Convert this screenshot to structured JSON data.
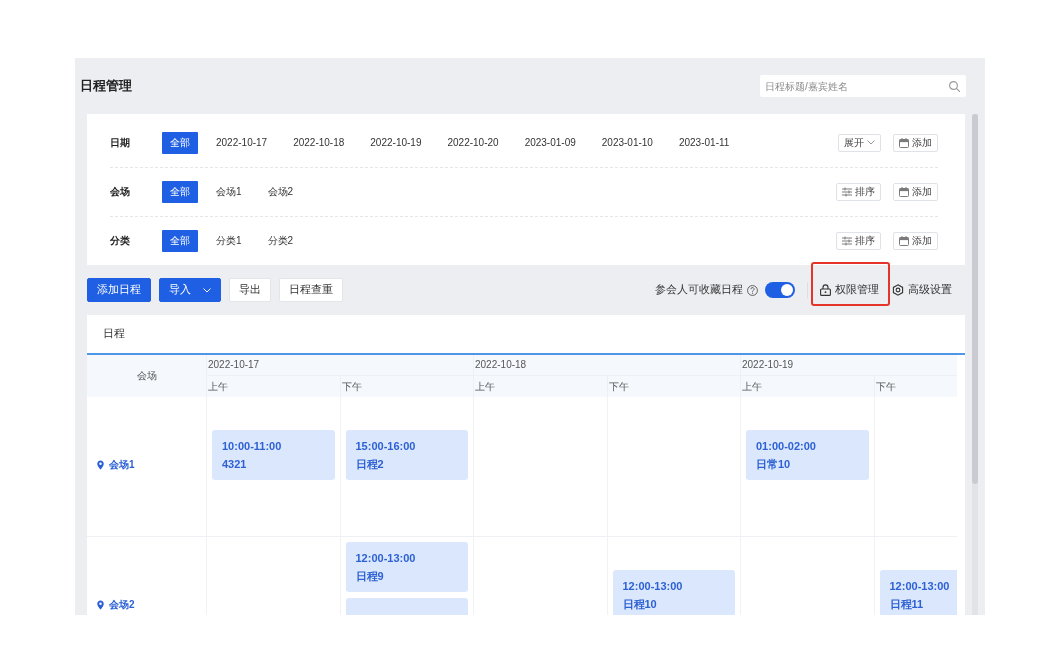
{
  "page": {
    "title": "日程管理"
  },
  "search": {
    "placeholder": "日程标题/嘉宾姓名"
  },
  "filters": [
    {
      "label": "日期",
      "options": [
        {
          "label": "全部",
          "selected": true
        },
        {
          "label": "2022-10-17",
          "selected": false
        },
        {
          "label": "2022-10-18",
          "selected": false
        },
        {
          "label": "2022-10-19",
          "selected": false
        },
        {
          "label": "2022-10-20",
          "selected": false
        },
        {
          "label": "2023-01-09",
          "selected": false
        },
        {
          "label": "2023-01-10",
          "selected": false
        },
        {
          "label": "2023-01-11",
          "selected": false
        }
      ],
      "actions": [
        {
          "kind": "expand",
          "label": "展开"
        },
        {
          "kind": "add",
          "label": "添加"
        }
      ]
    },
    {
      "label": "会场",
      "options": [
        {
          "label": "全部",
          "selected": true
        },
        {
          "label": "会场1",
          "selected": false
        },
        {
          "label": "会场2",
          "selected": false
        }
      ],
      "actions": [
        {
          "kind": "sort",
          "label": "排序"
        },
        {
          "kind": "add",
          "label": "添加"
        }
      ]
    },
    {
      "label": "分类",
      "options": [
        {
          "label": "全部",
          "selected": true
        },
        {
          "label": "分类1",
          "selected": false
        },
        {
          "label": "分类2",
          "selected": false
        }
      ],
      "actions": [
        {
          "kind": "sort",
          "label": "排序"
        },
        {
          "kind": "add",
          "label": "添加"
        }
      ]
    }
  ],
  "toolbar": {
    "buttons": [
      {
        "label": "添加日程",
        "kind": "primary",
        "dropdown": false
      },
      {
        "label": "导入",
        "kind": "primary",
        "dropdown": true
      },
      {
        "label": "导出",
        "kind": "default",
        "dropdown": false
      },
      {
        "label": "日程查重",
        "kind": "default",
        "dropdown": false
      }
    ],
    "favorite_toggle": {
      "label": "参会人可收藏日程",
      "on": true
    },
    "actions": [
      {
        "kind": "permissions",
        "label": "权限管理",
        "highlighted": true
      },
      {
        "kind": "settings",
        "label": "高级设置",
        "highlighted": false
      }
    ]
  },
  "schedule": {
    "tabs": [
      {
        "label": "日程",
        "selected": true
      }
    ],
    "venue_header": "会场",
    "dates": [
      {
        "label": "2022-10-17",
        "halves": [
          "上午",
          "下午"
        ]
      },
      {
        "label": "2022-10-18",
        "halves": [
          "上午",
          "下午"
        ]
      },
      {
        "label": "2022-10-19",
        "halves": [
          "上午",
          "下午"
        ]
      }
    ],
    "venues": [
      {
        "name": "会场1",
        "slots": [
          {
            "kind": "events",
            "events": [
              {
                "kind": "entry",
                "time": "10:00-11:00",
                "title": "4321"
              }
            ]
          },
          {
            "kind": "events",
            "events": [
              {
                "kind": "entry",
                "time": "15:00-16:00",
                "title": "日程2"
              }
            ]
          },
          {
            "kind": "empty"
          },
          {
            "kind": "empty"
          },
          {
            "kind": "events",
            "events": [
              {
                "kind": "entry",
                "time": "01:00-02:00",
                "title": "日常10"
              }
            ]
          },
          {
            "kind": "empty"
          }
        ]
      },
      {
        "name": "会场2",
        "slots": [
          {
            "kind": "empty"
          },
          {
            "kind": "events",
            "events": [
              {
                "kind": "entry",
                "time": "12:00-13:00",
                "title": "日程9"
              },
              {
                "kind": "stub"
              }
            ]
          },
          {
            "kind": "empty"
          },
          {
            "kind": "events",
            "events": [
              {
                "kind": "entry",
                "time": "12:00-13:00",
                "title": "日程10"
              }
            ]
          },
          {
            "kind": "empty"
          },
          {
            "kind": "events",
            "events": [
              {
                "kind": "entry",
                "time": "12:00-13:00",
                "title": "日程11"
              }
            ]
          }
        ]
      }
    ]
  }
}
